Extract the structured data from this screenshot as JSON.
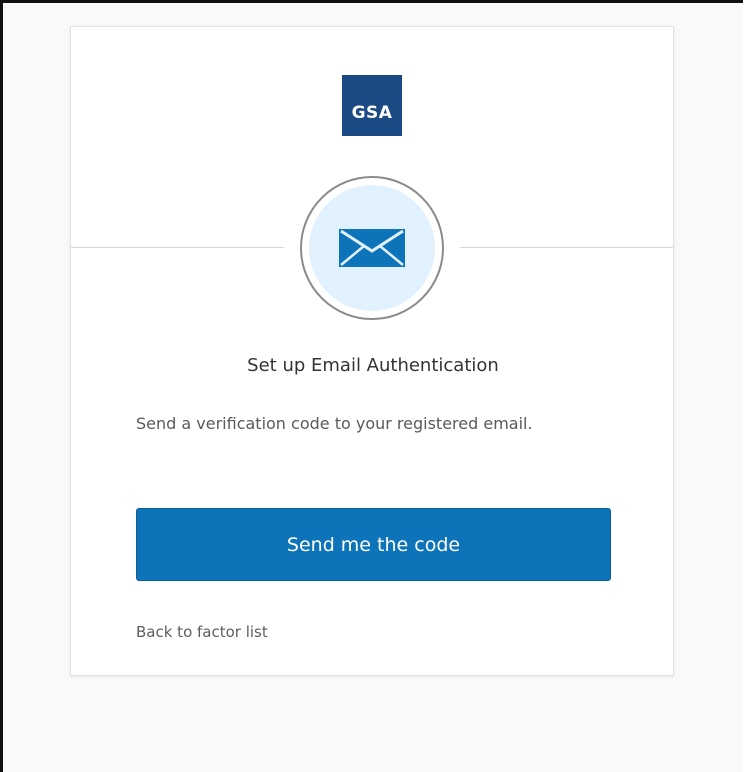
{
  "logo": {
    "text": "GSA",
    "color": "#1b4a85"
  },
  "beacon": {
    "icon": "envelope-icon",
    "bg_color": "#e1f1fd",
    "icon_color": "#0e74b9"
  },
  "title": "Set up Email Authentication",
  "subtitle": "Send a verification code to your registered email.",
  "send_button": {
    "label": "Send me the code",
    "color": "#0e74b9"
  },
  "back_link": {
    "label": "Back to factor list"
  }
}
